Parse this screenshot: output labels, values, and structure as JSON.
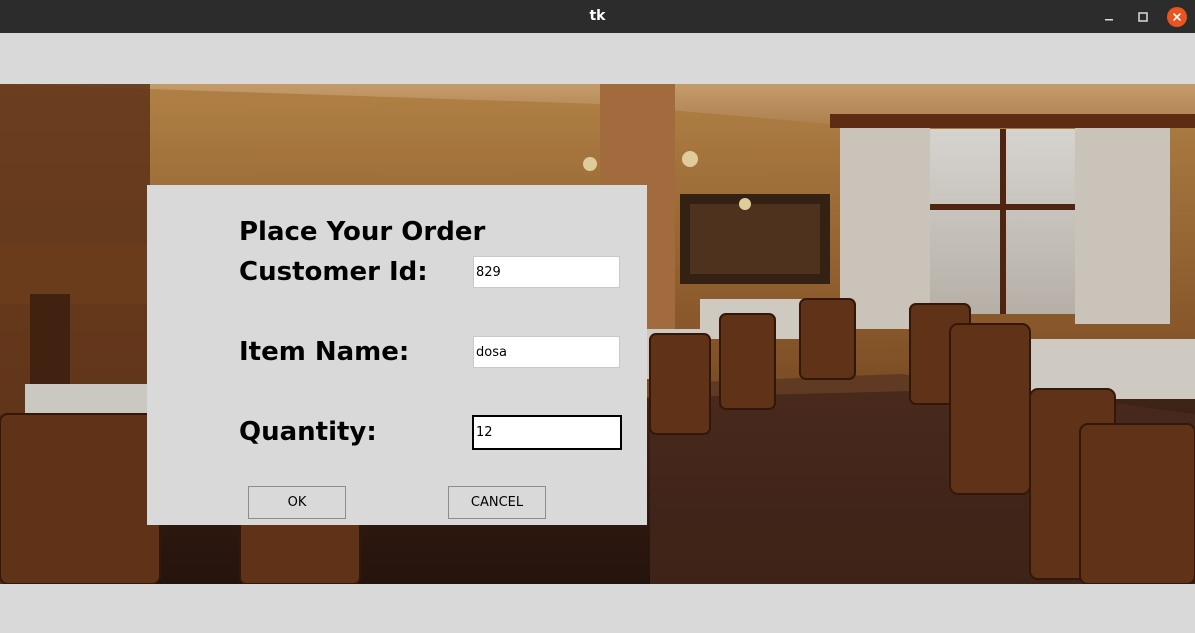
{
  "window": {
    "title": "tk",
    "close_color": "#e95420"
  },
  "form": {
    "heading": "Place Your Order",
    "fields": [
      {
        "label": "Customer Id:",
        "value": "829"
      },
      {
        "label": "Item Name:",
        "value": "dosa"
      },
      {
        "label": "Quantity:",
        "value": "12"
      }
    ],
    "buttons": {
      "ok": "OK",
      "cancel": "CANCEL"
    }
  },
  "background": {
    "description_icon": "restaurant-photo"
  }
}
